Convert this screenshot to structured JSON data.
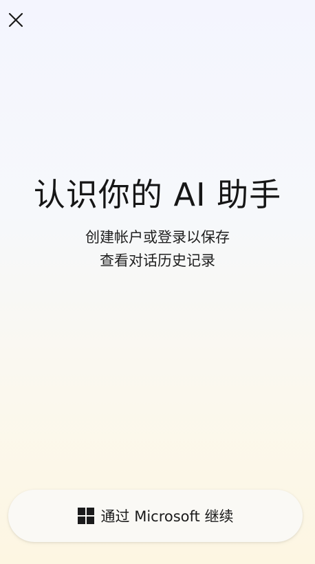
{
  "header": {
    "close_icon": "close-icon"
  },
  "hero": {
    "title": "认识你的 AI 助手",
    "subtitle_line1": "创建帐户或登录以保存",
    "subtitle_line2": "查看对话历史记录"
  },
  "signin": {
    "icon": "windows-logo-icon",
    "label": "通过 Microsoft 继续"
  },
  "colors": {
    "background_top": "#f4f5fe",
    "background_bottom": "#fdf6e2",
    "button_background": "#faf9f5",
    "text": "#1a1a1a"
  }
}
